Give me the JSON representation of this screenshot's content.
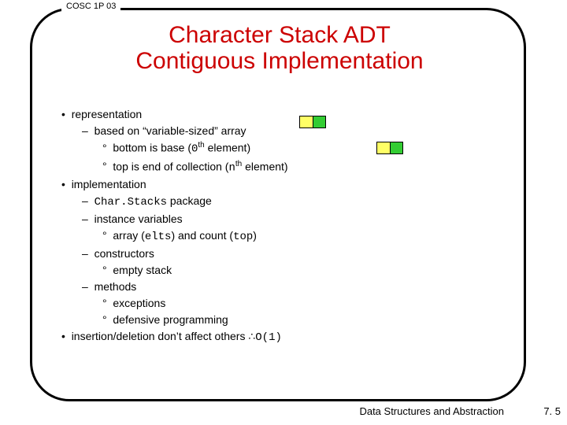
{
  "course": "COSC 1P 03",
  "title_line1": "Character Stack ADT",
  "title_line2": "Contiguous Implementation",
  "bullets": {
    "b1": "representation",
    "b1a_pre": "based on “variable-sized” array",
    "b1a1_pre": "bottom is base (",
    "b1a1_code": "0",
    "b1a1_post": " element)",
    "b1a2_pre": "top is end of collection (",
    "b1a2_code": "n",
    "b1a2_post": " element)",
    "b2": "implementation",
    "b2a_code": "Char.Stacks",
    "b2a_post": " package",
    "b2b": "instance variables",
    "b2b1_pre": "array (",
    "b2b1_c1": "elts",
    "b2b1_mid": ") and count (",
    "b2b1_c2": "top",
    "b2b1_post": ")",
    "b2c": "constructors",
    "b2c1": "empty stack",
    "b2d": "methods",
    "b2d1": "exceptions",
    "b2d2": "defensive programming",
    "b3_pre": "insertion/deletion don’t affect others  ",
    "b3_sym": "∴",
    "b3_code": "O(1)"
  },
  "footer": "Data Structures and Abstraction",
  "page": "7. 5",
  "th": "th"
}
